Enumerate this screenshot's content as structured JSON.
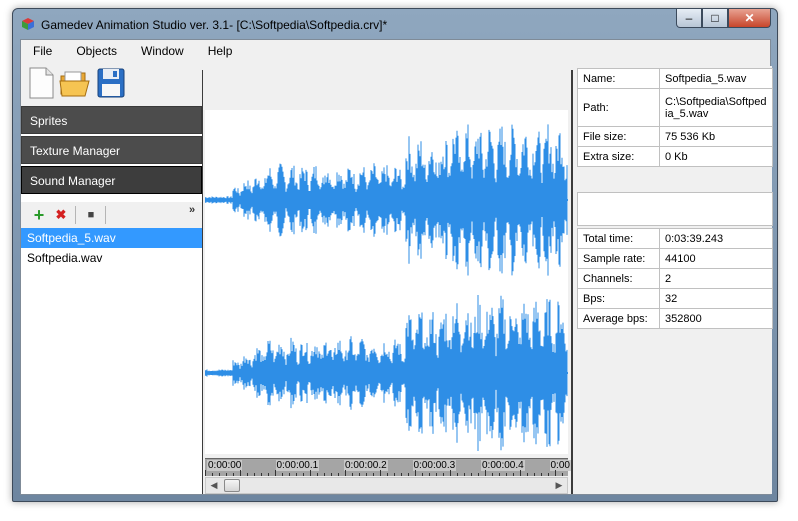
{
  "window": {
    "title": "Gamedev Animation Studio ver. 3.1- [C:\\Softpedia\\Softpedia.crv]*",
    "minimize_label": "–",
    "maximize_label": "□",
    "close_label": "✕"
  },
  "menu": [
    "File",
    "Objects",
    "Window",
    "Help"
  ],
  "toolbar": {
    "icons": [
      "new-file-icon",
      "open-folder-icon",
      "save-floppy-icon"
    ]
  },
  "nav": {
    "sprites": "Sprites",
    "texture_manager": "Texture Manager",
    "sound_manager": "Sound Manager"
  },
  "sound_toolbar": {
    "add": "+",
    "remove": "✖",
    "stop": "■",
    "overflow": "»"
  },
  "files": [
    "Softpedia_5.wav",
    "Softpedia.wav"
  ],
  "timeline": {
    "ticks": [
      "0:00:00",
      "0:00:00.1",
      "0:00:00.2",
      "0:00:00.3",
      "0:00:00.4",
      "0:00"
    ]
  },
  "colors": {
    "waveform": "#2e8ee6",
    "selection": "#3399ff",
    "nav_bg": "#4c4c4c"
  },
  "file_info": [
    {
      "key": "Name:",
      "value": "Softpedia_5.wav"
    },
    {
      "key": "Path:",
      "value": "C:\\Softpedia\\Softpedia_5.wav"
    },
    {
      "key": "File size:",
      "value": "75 536 Kb"
    },
    {
      "key": "Extra size:",
      "value": " 0 Kb"
    }
  ],
  "audio_info": [
    {
      "key": "Total time:",
      "value": "0:03:39.243"
    },
    {
      "key": "Sample rate:",
      "value": "44100"
    },
    {
      "key": "Channels:",
      "value": "2"
    },
    {
      "key": "Bps:",
      "value": "32"
    },
    {
      "key": "Average bps:",
      "value": "352800"
    }
  ]
}
